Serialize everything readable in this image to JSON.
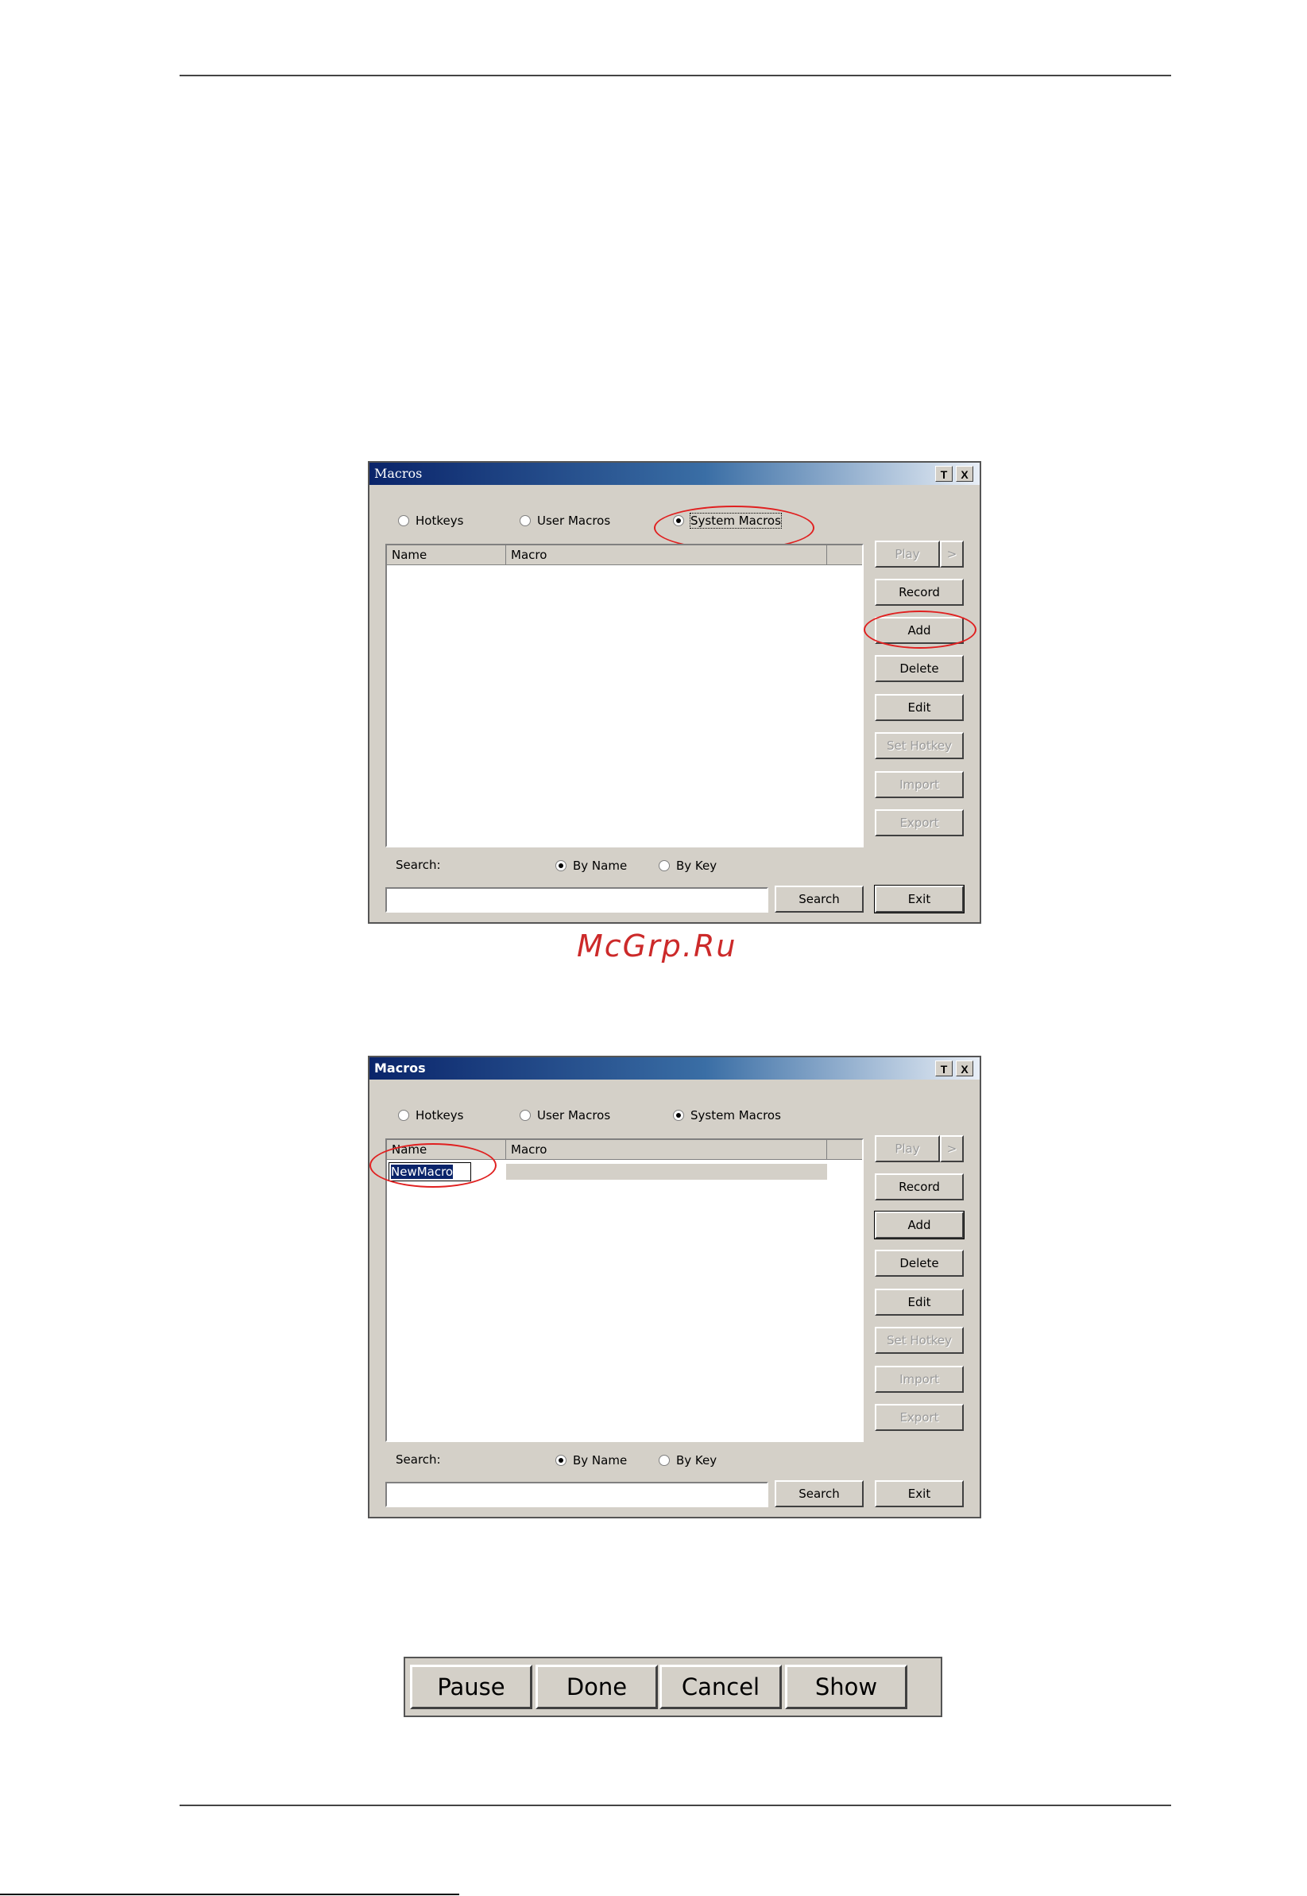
{
  "dialogs": [
    {
      "title": "Macros",
      "title_style": "serif",
      "tb_t": "T",
      "tb_x": "X",
      "radios": [
        "Hotkeys",
        "User Macros",
        "System Macros"
      ],
      "selected_radio": "System Macros",
      "columns": [
        "Name",
        "Macro"
      ],
      "editing_name": "",
      "buttons": {
        "play": "Play",
        "play_arrow": ">",
        "record": "Record",
        "add": "Add",
        "delete": "Delete",
        "edit": "Edit",
        "set_hotkey": "Set Hotkey",
        "import": "Import",
        "export": "Export",
        "search": "Search",
        "exit": "Exit"
      },
      "search_label": "Search:",
      "search_by": [
        "By Name",
        "By Key"
      ],
      "search_by_selected": "By Name",
      "search_value": ""
    },
    {
      "title": "Macros",
      "title_style": "bold",
      "tb_t": "T",
      "tb_x": "X",
      "radios": [
        "Hotkeys",
        "User Macros",
        "System Macros"
      ],
      "selected_radio": "System Macros",
      "columns": [
        "Name",
        "Macro"
      ],
      "editing_name": "NewMacro",
      "buttons": {
        "play": "Play",
        "play_arrow": ">",
        "record": "Record",
        "add": "Add",
        "delete": "Delete",
        "edit": "Edit",
        "set_hotkey": "Set Hotkey",
        "import": "Import",
        "export": "Export",
        "search": "Search",
        "exit": "Exit"
      },
      "search_label": "Search:",
      "search_by": [
        "By Name",
        "By Key"
      ],
      "search_by_selected": "By Name",
      "search_value": ""
    }
  ],
  "watermark": "McGrp.Ru",
  "record_toolbar": [
    "Pause",
    "Done",
    "Cancel",
    "Show"
  ]
}
